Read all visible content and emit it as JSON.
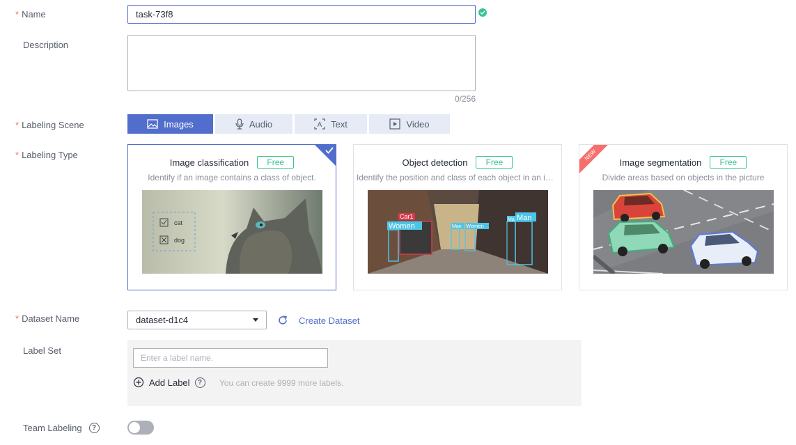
{
  "form": {
    "name": {
      "label": "Name",
      "required_mark": "*",
      "value": "task-73f8"
    },
    "description": {
      "label": "Description",
      "value": "",
      "counter": "0/256"
    },
    "scene": {
      "label": "Labeling Scene",
      "required_mark": "*",
      "tabs": [
        {
          "label": "Images",
          "icon": "image-icon",
          "active": true
        },
        {
          "label": "Audio",
          "icon": "microphone-icon",
          "active": false
        },
        {
          "label": "Text",
          "icon": "text-icon",
          "active": false
        },
        {
          "label": "Video",
          "icon": "video-icon",
          "active": false
        }
      ]
    },
    "type": {
      "label": "Labeling Type",
      "required_mark": "*",
      "cards": [
        {
          "title": "Image classification",
          "badge": "Free",
          "desc": "Identify if an image contains a class of object.",
          "selected": true,
          "image_labels": [
            "cat",
            "dog"
          ]
        },
        {
          "title": "Object detection",
          "badge": "Free",
          "desc": "Identify the position and class of each object in an image.",
          "selected": false,
          "image_labels": [
            "Car1",
            "Women",
            "Man",
            "Women",
            "Ma",
            "Man"
          ]
        },
        {
          "title": "Image segmentation",
          "badge": "Free",
          "desc": "Divide areas based on objects in the picture",
          "selected": false,
          "ribbon": "NEW"
        }
      ]
    },
    "dataset": {
      "label": "Dataset Name",
      "required_mark": "*",
      "value": "dataset-d1c4",
      "create_label": "Create Dataset"
    },
    "label_set": {
      "label": "Label Set",
      "placeholder": "Enter a label name.",
      "add_label": "Add Label",
      "hint": "You can create 9999 more labels."
    },
    "team": {
      "label": "Team Labeling",
      "enabled": false
    }
  },
  "colors": {
    "primary": "#526ecc",
    "success": "#3ac295",
    "required": "#f66f6a",
    "new_ribbon": "#f66f6a"
  }
}
